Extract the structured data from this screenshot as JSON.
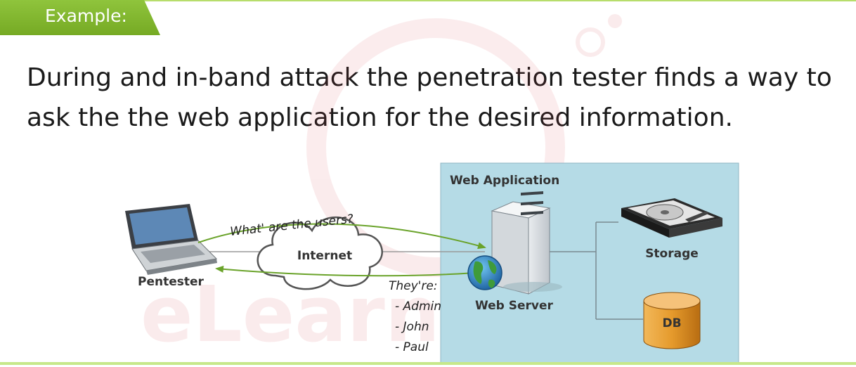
{
  "tag": {
    "label": "Example:"
  },
  "headline": "During and in-band attack the penetration tester finds a way to ask the the web application for the desired information.",
  "diagram": {
    "pentester_label": "Pentester",
    "internet_label": "Internet",
    "webapp_label": "Web Application",
    "webserver_label": "Web Server",
    "storage_label": "Storage",
    "db_label": "DB",
    "question": "What' are the users?",
    "answer_intro": "They're:",
    "answers": [
      "- Admin",
      "- John",
      "- Paul"
    ]
  },
  "watermark": {
    "text": "eLearn"
  },
  "colors": {
    "accent": "#7cb22c",
    "panel": "#b5dbe6",
    "arrow": "#6aa32a"
  }
}
